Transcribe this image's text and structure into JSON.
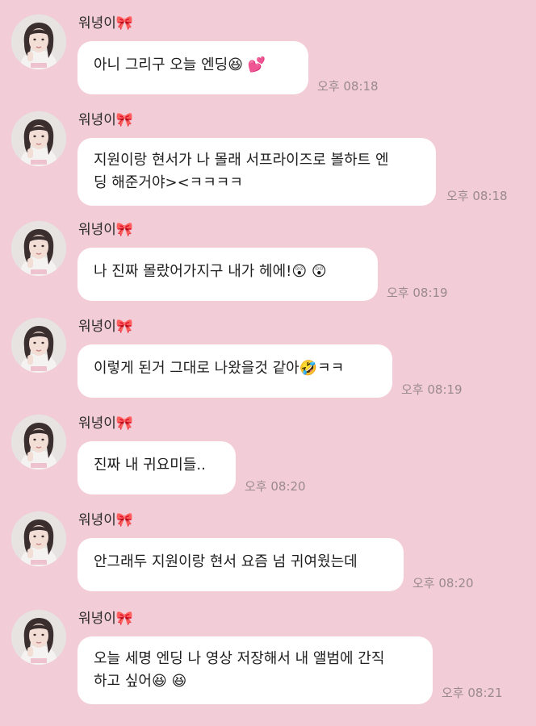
{
  "messages": [
    {
      "sender": "워녕이🎀",
      "lines": [
        "아니 그리구 오늘 엔딩😆 💕"
      ],
      "time": "오후 08:18"
    },
    {
      "sender": "워녕이🎀",
      "lines": [
        "지원이랑 현서가 나 몰래 서프라이즈로 볼하트 엔",
        "딩 해준거야><ㅋㅋㅋㅋ"
      ],
      "time": "오후 08:18"
    },
    {
      "sender": "워녕이🎀",
      "lines": [
        "나 진짜 몰랐어가지구 내가 헤에!😲 😲"
      ],
      "time": "오후 08:19"
    },
    {
      "sender": "워녕이🎀",
      "lines": [
        "이렇게 된거 그대로 나왔을것 같아🤣ㅋㅋ"
      ],
      "time": "오후 08:19"
    },
    {
      "sender": "워녕이🎀",
      "lines": [
        "진짜 내 귀요미들.."
      ],
      "time": "오후 08:20"
    },
    {
      "sender": "워녕이🎀",
      "lines": [
        "안그래두 지원이랑 현서 요즘 넘 귀여웠는데"
      ],
      "time": "오후 08:20"
    },
    {
      "sender": "워녕이🎀",
      "lines": [
        "오늘 세명 엔딩 나 영상 저장해서 내 앨범에 간직",
        "하고 싶어😆 😆"
      ],
      "time": "오후 08:21"
    }
  ],
  "colors": {
    "background": "#f2ccd6",
    "bubble": "#ffffff",
    "time_text": "#9a8a8f"
  },
  "icons": {
    "avatar": "profile-avatar",
    "bow": "ribbon-bow-icon"
  }
}
